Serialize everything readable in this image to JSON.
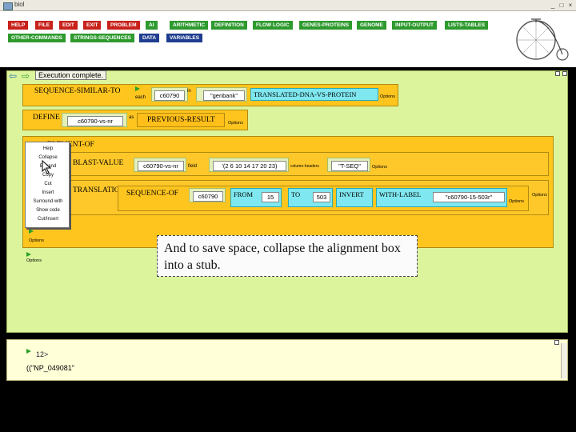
{
  "window": {
    "title": "biol",
    "min_glyph": "_",
    "max_glyph": "□",
    "close_glyph": "×"
  },
  "menu": {
    "row1": [
      {
        "label": "HELP",
        "color": "#c8211b"
      },
      {
        "label": "FILE",
        "color": "#c8211b"
      },
      {
        "label": "EDIT",
        "color": "#c8211b"
      },
      {
        "label": "EXIT",
        "color": "#c8211b"
      },
      {
        "label": "PROBLEM",
        "color": "#c8211b"
      },
      {
        "label": "AI",
        "color": "#2e9a2e"
      },
      {
        "label": "ARITHMETIC",
        "color": "#2e9a2e"
      },
      {
        "label": "DEFINITION",
        "color": "#2e9a2e"
      },
      {
        "label": "FLOW LOGIC",
        "color": "#2e9a2e"
      },
      {
        "label": "GENES-PROTEINS",
        "color": "#2e9a2e"
      },
      {
        "label": "GENOME",
        "color": "#2e9a2e"
      },
      {
        "label": "INPUT-OUTPUT",
        "color": "#2e9a2e"
      },
      {
        "label": "LISTS-TABLES",
        "color": "#2e9a2e"
      }
    ],
    "row2": [
      {
        "label": "OTHER-COMMANDS",
        "color": "#2e9a2e"
      },
      {
        "label": "STRINGS-SEQUENCES",
        "color": "#2e9a2e"
      },
      {
        "label": "DATA",
        "color": "#1f3d8f"
      },
      {
        "label": "VARIABLES",
        "color": "#1f3d8f"
      }
    ]
  },
  "status": {
    "text": "Execution complete."
  },
  "seq_similar": {
    "label": "SEQUENCE-SIMILAR-TO",
    "each_label": "each",
    "query": "c60790",
    "in_label": "in",
    "db": "\"genbank\"",
    "mode": "TRANSLATED-DNA-VS-PROTEIN",
    "options": "Options"
  },
  "define": {
    "label": "DEFINE",
    "var": "c60790-vs-nr",
    "as_label": "as",
    "value": "PREVIOUS-RESULT",
    "options": "Options"
  },
  "element_of": {
    "label": "ELEMENT-OF",
    "blast": {
      "label": "BLAST-VALUE",
      "var": "c60790-vs-nr",
      "field_label": "field",
      "indices": "'(2 6 10 14 17 20 23)",
      "coln_label": "column-headers",
      "tseq": "\"T-SEQ\"",
      "options": "Options"
    },
    "translation": {
      "label": "TRANSLATION-OF",
      "seq_label": "SEQUENCE-OF",
      "seq_value": "c60790",
      "from_label": "FROM",
      "from_value": "15",
      "to_label": "TO",
      "to_value": "503",
      "invert_label": "INVERT",
      "withlabel_label": "WITH-LABEL",
      "withlabel_value": "\"c60790-15-503r\"",
      "options": "Options"
    },
    "options": "Options"
  },
  "outer_options": "Options",
  "context_menu": [
    "Help",
    "Collapse",
    "Expand",
    "Copy",
    "Cut",
    "Insert",
    "Surround with",
    "Show code",
    "Cut/Insert"
  ],
  "callout": {
    "text": "And to save space, collapse the alignment box into a stub."
  },
  "bottom": {
    "prompt": "12>",
    "result": "((\"NP_049081\""
  }
}
